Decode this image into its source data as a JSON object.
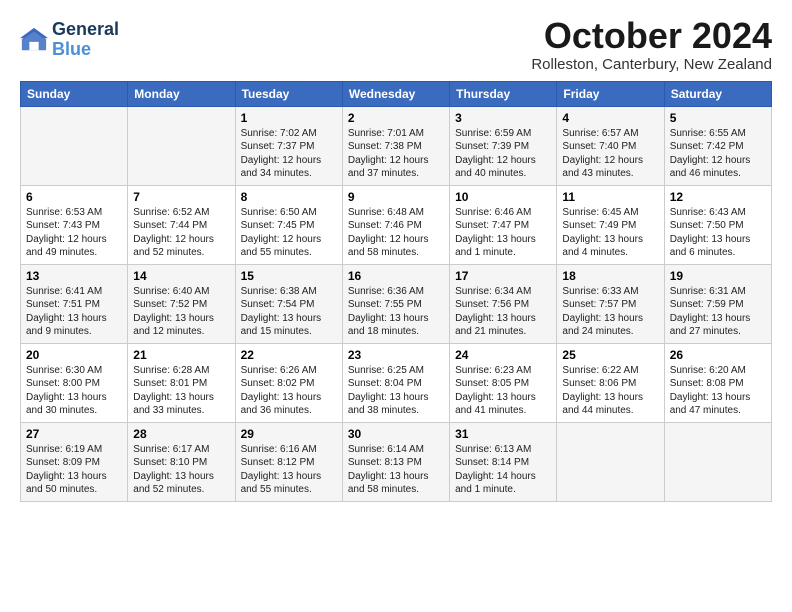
{
  "app": {
    "logo_line1": "General",
    "logo_line2": "Blue"
  },
  "header": {
    "title": "October 2024",
    "subtitle": "Rolleston, Canterbury, New Zealand"
  },
  "days_of_week": [
    "Sunday",
    "Monday",
    "Tuesday",
    "Wednesday",
    "Thursday",
    "Friday",
    "Saturday"
  ],
  "weeks": [
    [
      {
        "day": "",
        "info": ""
      },
      {
        "day": "",
        "info": ""
      },
      {
        "day": "1",
        "info": "Sunrise: 7:02 AM\nSunset: 7:37 PM\nDaylight: 12 hours\nand 34 minutes."
      },
      {
        "day": "2",
        "info": "Sunrise: 7:01 AM\nSunset: 7:38 PM\nDaylight: 12 hours\nand 37 minutes."
      },
      {
        "day": "3",
        "info": "Sunrise: 6:59 AM\nSunset: 7:39 PM\nDaylight: 12 hours\nand 40 minutes."
      },
      {
        "day": "4",
        "info": "Sunrise: 6:57 AM\nSunset: 7:40 PM\nDaylight: 12 hours\nand 43 minutes."
      },
      {
        "day": "5",
        "info": "Sunrise: 6:55 AM\nSunset: 7:42 PM\nDaylight: 12 hours\nand 46 minutes."
      }
    ],
    [
      {
        "day": "6",
        "info": "Sunrise: 6:53 AM\nSunset: 7:43 PM\nDaylight: 12 hours\nand 49 minutes."
      },
      {
        "day": "7",
        "info": "Sunrise: 6:52 AM\nSunset: 7:44 PM\nDaylight: 12 hours\nand 52 minutes."
      },
      {
        "day": "8",
        "info": "Sunrise: 6:50 AM\nSunset: 7:45 PM\nDaylight: 12 hours\nand 55 minutes."
      },
      {
        "day": "9",
        "info": "Sunrise: 6:48 AM\nSunset: 7:46 PM\nDaylight: 12 hours\nand 58 minutes."
      },
      {
        "day": "10",
        "info": "Sunrise: 6:46 AM\nSunset: 7:47 PM\nDaylight: 13 hours\nand 1 minute."
      },
      {
        "day": "11",
        "info": "Sunrise: 6:45 AM\nSunset: 7:49 PM\nDaylight: 13 hours\nand 4 minutes."
      },
      {
        "day": "12",
        "info": "Sunrise: 6:43 AM\nSunset: 7:50 PM\nDaylight: 13 hours\nand 6 minutes."
      }
    ],
    [
      {
        "day": "13",
        "info": "Sunrise: 6:41 AM\nSunset: 7:51 PM\nDaylight: 13 hours\nand 9 minutes."
      },
      {
        "day": "14",
        "info": "Sunrise: 6:40 AM\nSunset: 7:52 PM\nDaylight: 13 hours\nand 12 minutes."
      },
      {
        "day": "15",
        "info": "Sunrise: 6:38 AM\nSunset: 7:54 PM\nDaylight: 13 hours\nand 15 minutes."
      },
      {
        "day": "16",
        "info": "Sunrise: 6:36 AM\nSunset: 7:55 PM\nDaylight: 13 hours\nand 18 minutes."
      },
      {
        "day": "17",
        "info": "Sunrise: 6:34 AM\nSunset: 7:56 PM\nDaylight: 13 hours\nand 21 minutes."
      },
      {
        "day": "18",
        "info": "Sunrise: 6:33 AM\nSunset: 7:57 PM\nDaylight: 13 hours\nand 24 minutes."
      },
      {
        "day": "19",
        "info": "Sunrise: 6:31 AM\nSunset: 7:59 PM\nDaylight: 13 hours\nand 27 minutes."
      }
    ],
    [
      {
        "day": "20",
        "info": "Sunrise: 6:30 AM\nSunset: 8:00 PM\nDaylight: 13 hours\nand 30 minutes."
      },
      {
        "day": "21",
        "info": "Sunrise: 6:28 AM\nSunset: 8:01 PM\nDaylight: 13 hours\nand 33 minutes."
      },
      {
        "day": "22",
        "info": "Sunrise: 6:26 AM\nSunset: 8:02 PM\nDaylight: 13 hours\nand 36 minutes."
      },
      {
        "day": "23",
        "info": "Sunrise: 6:25 AM\nSunset: 8:04 PM\nDaylight: 13 hours\nand 38 minutes."
      },
      {
        "day": "24",
        "info": "Sunrise: 6:23 AM\nSunset: 8:05 PM\nDaylight: 13 hours\nand 41 minutes."
      },
      {
        "day": "25",
        "info": "Sunrise: 6:22 AM\nSunset: 8:06 PM\nDaylight: 13 hours\nand 44 minutes."
      },
      {
        "day": "26",
        "info": "Sunrise: 6:20 AM\nSunset: 8:08 PM\nDaylight: 13 hours\nand 47 minutes."
      }
    ],
    [
      {
        "day": "27",
        "info": "Sunrise: 6:19 AM\nSunset: 8:09 PM\nDaylight: 13 hours\nand 50 minutes."
      },
      {
        "day": "28",
        "info": "Sunrise: 6:17 AM\nSunset: 8:10 PM\nDaylight: 13 hours\nand 52 minutes."
      },
      {
        "day": "29",
        "info": "Sunrise: 6:16 AM\nSunset: 8:12 PM\nDaylight: 13 hours\nand 55 minutes."
      },
      {
        "day": "30",
        "info": "Sunrise: 6:14 AM\nSunset: 8:13 PM\nDaylight: 13 hours\nand 58 minutes."
      },
      {
        "day": "31",
        "info": "Sunrise: 6:13 AM\nSunset: 8:14 PM\nDaylight: 14 hours\nand 1 minute."
      },
      {
        "day": "",
        "info": ""
      },
      {
        "day": "",
        "info": ""
      }
    ]
  ]
}
